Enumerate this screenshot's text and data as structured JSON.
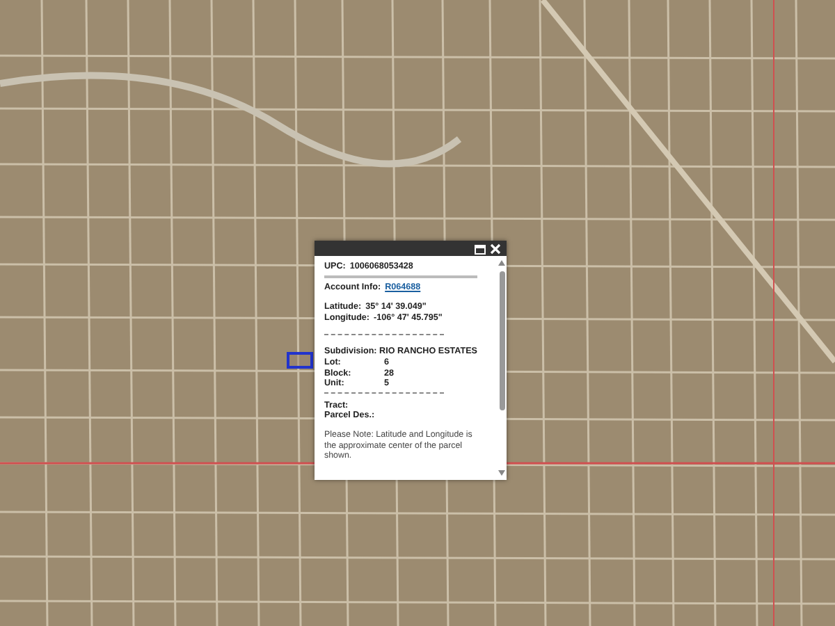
{
  "popup": {
    "header_fields": [
      {
        "label": "UPC:",
        "value": "1006068053428",
        "kind": "text"
      },
      {
        "label": "Account Info:",
        "value": "R064688",
        "kind": "link"
      }
    ],
    "coordinates": [
      {
        "label": "Latitude:",
        "value": "35° 14' 39.049\""
      },
      {
        "label": "Longitude:",
        "value": "-106° 47' 45.795\""
      }
    ],
    "subdivision": {
      "label": "Subdivision:",
      "value": "RIO RANCHO ESTATES"
    },
    "lot_fields": [
      {
        "label": "Lot:",
        "value": "6"
      },
      {
        "label": "Block:",
        "value": "28"
      },
      {
        "label": "Unit:",
        "value": "5"
      }
    ],
    "extra_fields": [
      {
        "label": "Tract:"
      },
      {
        "label": "Parcel Des.:"
      }
    ],
    "note": "Please Note: Latitude and Longitude is the approximate center of the parcel shown."
  }
}
